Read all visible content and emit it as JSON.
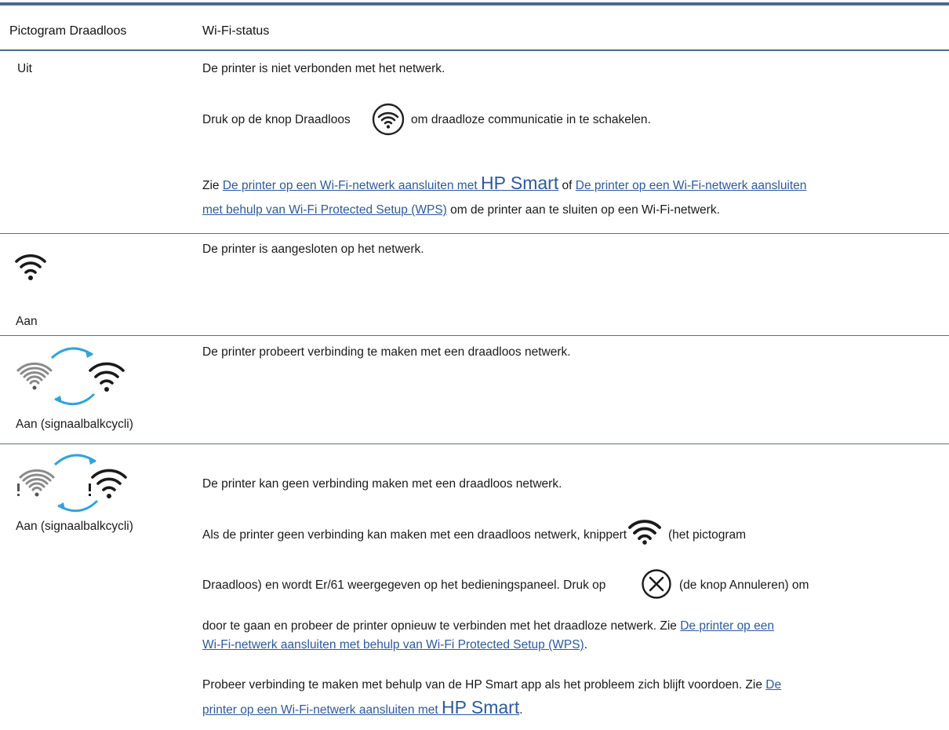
{
  "table": {
    "headers": {
      "icon_col": "Pictogram Draadloos",
      "status_col": "Wi-Fi-status"
    },
    "rows": [
      {
        "label": "Uit",
        "line1": "De printer is niet verbonden met het netwerk.",
        "line2_before": "Druk op de knop Draadloos",
        "line2_after": "om draadloze communicatie in te schakelen.",
        "line3_zie": "Zie",
        "link1_text": "De printer op een Wi-Fi-netwerk aansluiten met",
        "link1_brand": "HP Smart",
        "of": "of",
        "link2_part1": "De printer op een Wi-Fi-netwerk aansluiten",
        "link2_part2": "met behulp van Wi-Fi Protected Setup (WPS)",
        "line4_after": "om de printer aan te sluiten op een Wi-Fi-netwerk."
      },
      {
        "label": "Aan",
        "line1": "De printer is aangesloten op het netwerk.",
        "icon": "wifi-icon"
      },
      {
        "label": "Aan (signaalbalkcycli)",
        "line1": "De printer probeert verbinding te maken met een draadloos netwerk.",
        "icon": "wifi-cycling-icon"
      },
      {
        "label": "Aan (signaalbalkcycli)",
        "icon": "wifi-cycling-error-icon",
        "line1": "De printer kan geen verbinding maken met een draadloos netwerk.",
        "line2_before": "Als de printer geen verbinding kan maken met een draadloos netwerk, knippert",
        "line2_after": "(het pictogram",
        "line3_before": "Draadloos) en wordt Er/61 weergegeven op het bedieningspaneel. Druk op",
        "line3_after": "(de knop Annuleren) om",
        "line4_before": "door te gaan en probeer de printer opnieuw te verbinden met het draadloze netwerk. Zie",
        "line4_link": "De printer op een",
        "line5_link": "Wi-Fi-netwerk aansluiten met behulp van Wi-Fi Protected Setup (WPS)",
        "line5_end": ".",
        "line6_before": "Probeer verbinding te maken met behulp van de HP Smart app als het probleem zich blijft voordoen. Zie",
        "line6_link": "De",
        "line7_link": "printer op een Wi-Fi-netwerk aansluiten met",
        "line7_brand": "HP Smart",
        "line7_end": "."
      }
    ]
  },
  "colors": {
    "rule": "#4a6990",
    "link": "#2c5aa0",
    "cycle_arrow": "#2fa3dc",
    "icon_gray": "#8a8a8a"
  }
}
